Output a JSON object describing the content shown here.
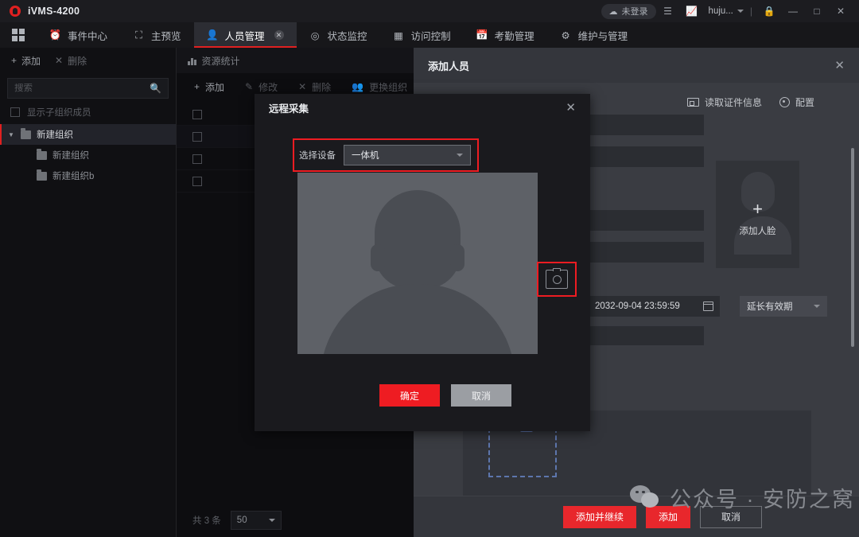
{
  "titlebar": {
    "app_title": "iVMS-4200",
    "login_status": "未登录",
    "user": "huju...",
    "icons": [
      "cloud-icon",
      "list-icon",
      "chart-icon",
      "caret-down-icon",
      "lock-icon",
      "minimize-icon",
      "maximize-icon",
      "close-icon"
    ]
  },
  "tabs": [
    {
      "label": "事件中心",
      "icon": "alarm-icon",
      "active": false
    },
    {
      "label": "主预览",
      "icon": "camera-icon",
      "active": false
    },
    {
      "label": "人员管理",
      "icon": "person-card-icon",
      "active": true,
      "closable": true
    },
    {
      "label": "状态监控",
      "icon": "target-icon",
      "active": false
    },
    {
      "label": "访问控制",
      "icon": "door-icon",
      "active": false
    },
    {
      "label": "考勤管理",
      "icon": "calendar-icon",
      "active": false
    },
    {
      "label": "维护与管理",
      "icon": "sliders-icon",
      "active": false
    }
  ],
  "sidebar": {
    "add_label": "添加",
    "delete_label": "删除",
    "search_placeholder": "搜索",
    "show_sub_label": "显示子组织成员",
    "tree": [
      {
        "label": "新建组织",
        "level": 0,
        "selected": true
      },
      {
        "label": "新建组织",
        "level": 1,
        "selected": false
      },
      {
        "label": "新建组织b",
        "level": 1,
        "selected": false
      }
    ]
  },
  "center": {
    "resource_stats_label": "资源统计",
    "tools": [
      {
        "label": "添加",
        "enabled": true
      },
      {
        "label": "修改",
        "enabled": false
      },
      {
        "label": "删除",
        "enabled": false
      },
      {
        "label": "更换组织",
        "enabled": false
      }
    ],
    "row_count": 4,
    "footer_total": "共 3 条",
    "page_size": "50"
  },
  "add_person": {
    "title": "添加人员",
    "read_id_label": "读取证件信息",
    "config_label": "配置",
    "face_add_label": "添加人脸",
    "face_plus": "+",
    "valid_date": "2032-09-04 23:59:59",
    "extend_label": "延长有效期",
    "buttons": {
      "add_continue": "添加并继续",
      "add": "添加",
      "cancel": "取消"
    }
  },
  "remote_dialog": {
    "title": "远程采集",
    "device_label": "选择设备",
    "device_value": "一体机",
    "capture_icon": "camera-icon",
    "ok_label": "确定",
    "cancel_label": "取消",
    "highlight_color": "#ee1c22"
  },
  "watermark": {
    "text": "公众号 · 安防之窝",
    "logo": "wechat-icon"
  },
  "colors": {
    "accent_red": "#e8272c",
    "panel_bg": "#3a3c42",
    "dialog_bg": "#1a1a1e"
  }
}
